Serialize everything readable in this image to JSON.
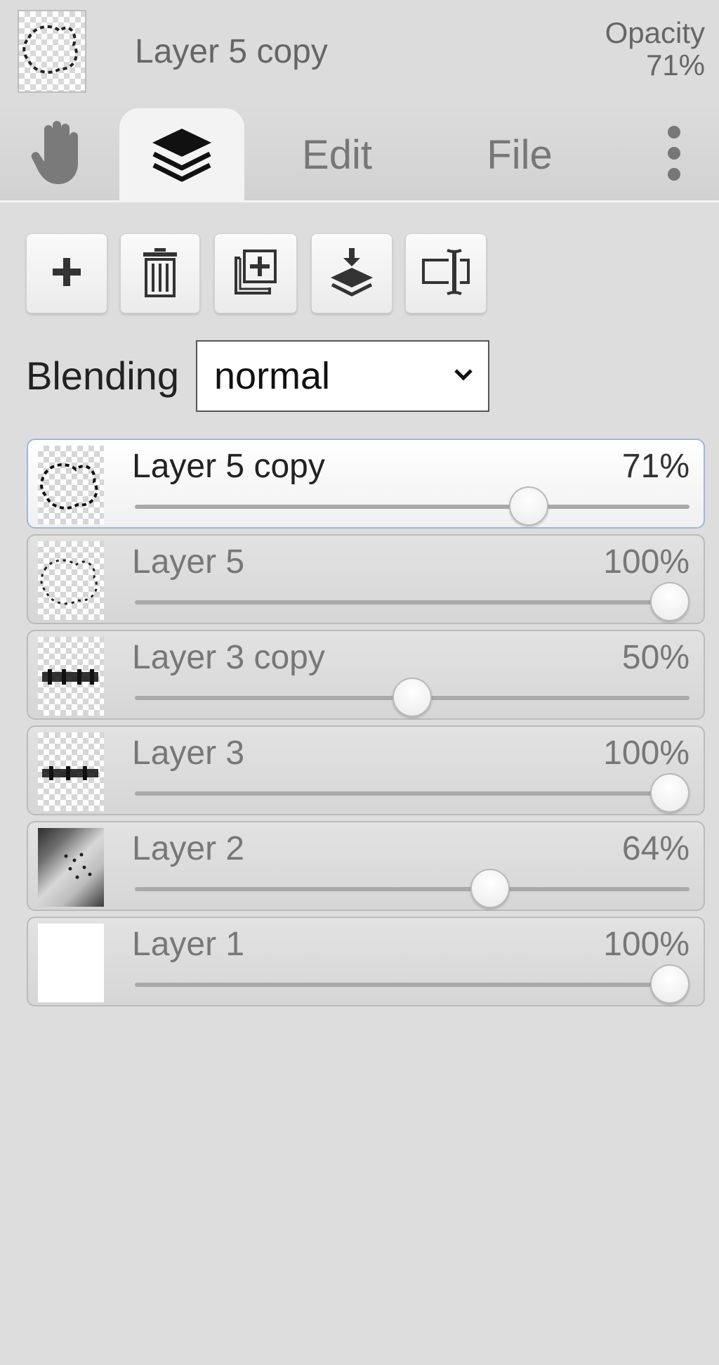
{
  "header": {
    "current_layer_name": "Layer 5 copy",
    "opacity_label": "Opacity",
    "opacity_value": "71%"
  },
  "tabs": [
    {
      "id": "hand",
      "label": "",
      "icon": "hand-icon"
    },
    {
      "id": "layers",
      "label": "",
      "icon": "layers-icon",
      "active": true
    },
    {
      "id": "edit",
      "label": "Edit"
    },
    {
      "id": "file",
      "label": "File"
    },
    {
      "id": "more",
      "label": "",
      "icon": "more-vertical-icon"
    }
  ],
  "toolbar": {
    "buttons": [
      {
        "icon": "plus-icon"
      },
      {
        "icon": "trash-icon"
      },
      {
        "icon": "duplicate-icon"
      },
      {
        "icon": "merge-down-icon"
      },
      {
        "icon": "rename-icon"
      }
    ]
  },
  "blending": {
    "label": "Blending",
    "value": "normal"
  },
  "layers": [
    {
      "name": "Layer 5 copy",
      "opacity": "71%",
      "opacity_fraction": 0.71,
      "selected": true,
      "thumb": "transparent-sketch"
    },
    {
      "name": "Layer 5",
      "opacity": "100%",
      "opacity_fraction": 1.0,
      "selected": false,
      "thumb": "transparent-sketch"
    },
    {
      "name": "Layer 3 copy",
      "opacity": "50%",
      "opacity_fraction": 0.5,
      "selected": false,
      "thumb": "transparent-text"
    },
    {
      "name": "Layer 3",
      "opacity": "100%",
      "opacity_fraction": 1.0,
      "selected": false,
      "thumb": "transparent-text"
    },
    {
      "name": "Layer 2",
      "opacity": "64%",
      "opacity_fraction": 0.64,
      "selected": false,
      "thumb": "photo"
    },
    {
      "name": "Layer 1",
      "opacity": "100%",
      "opacity_fraction": 1.0,
      "selected": false,
      "thumb": "white"
    }
  ],
  "colors": {
    "background": "#dddddd",
    "selected_border": "#9fb6dc"
  }
}
